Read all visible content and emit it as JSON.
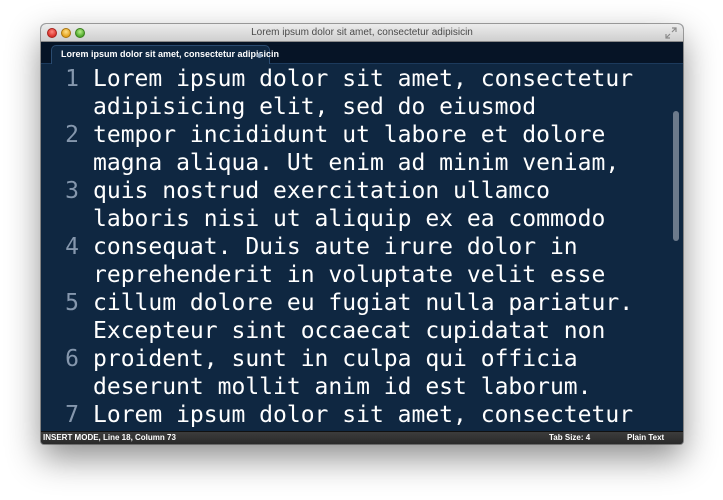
{
  "window": {
    "title": "Lorem ipsum dolor sit amet, consectetur adipisicin"
  },
  "tab": {
    "label": "Lorem ipsum dolor sit amet, consectetur adipisicin"
  },
  "editor": {
    "line_numbers": [
      "1",
      "2",
      "3",
      "4",
      "5",
      "6",
      "7"
    ],
    "lines": [
      "Lorem ipsum dolor sit amet, consectetur",
      "adipisicing elit, sed do eiusmod",
      "tempor incididunt ut labore et dolore",
      "magna aliqua. Ut enim ad minim veniam,",
      "quis nostrud exercitation ullamco",
      "laboris nisi ut aliquip ex ea commodo",
      "consequat. Duis aute irure dolor in",
      "reprehenderit in voluptate velit esse",
      "cillum dolore eu fugiat nulla pariatur.",
      "Excepteur sint occaecat cupidatat non",
      "proident, sunt in culpa qui officia",
      "deserunt mollit anim id est laborum.",
      "Lorem ipsum dolor sit amet, consectetur"
    ]
  },
  "status": {
    "mode": "INSERT MODE, Line 18, Column 73",
    "tab_size": "Tab Size: 4",
    "syntax": "Plain Text"
  },
  "colors": {
    "editor_background": "#0f2741",
    "text": "#ffffff",
    "line_number": "#8597ad"
  }
}
